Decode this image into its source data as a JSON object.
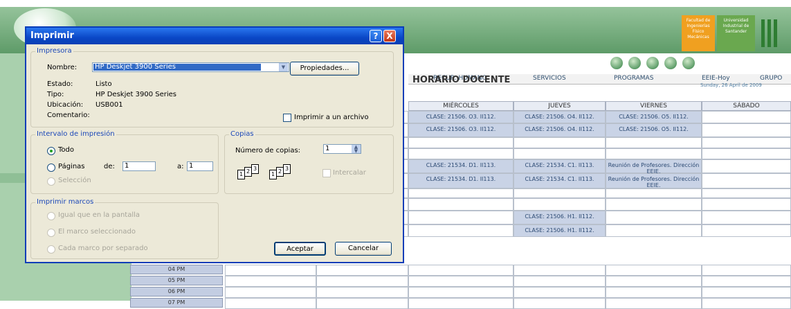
{
  "site": {
    "badge1": "Facultad de Ingenierías Físico Mecánicas",
    "badge2": "Universidad Industrial de Santander",
    "menu": [
      "RECUR. HUMANO",
      "SERVICIOS",
      "PROGRAMAS",
      "EEIE-Hoy",
      "GRUPO"
    ],
    "date": "Sunday, 26 April de 2009",
    "page_title": "HORARIO DOCENTE",
    "days": [
      "MIÉRCOLES",
      "JUEVES",
      "VIERNES",
      "SÁBADO"
    ],
    "rows": [
      [
        "CLASE: 21506. O3. II112.",
        "CLASE: 21506. O4. II112.",
        "CLASE: 21506. O5. II112.",
        ""
      ],
      [
        "CLASE: 21506. O3. II112.",
        "CLASE: 21506. O4. II112.",
        "CLASE: 21506. O5. II112.",
        ""
      ],
      [
        "",
        "",
        "",
        ""
      ],
      [
        "",
        "",
        "",
        ""
      ],
      [
        "CLASE: 21534. D1. II113.",
        "CLASE: 21534. C1. II113.",
        "Reunión de Profesores. Dirección EEIE.",
        ""
      ],
      [
        "CLASE: 21534. D1. II113.",
        "CLASE: 21534. C1. II113.",
        "Reunión de Profesores. Dirección EEIE.",
        ""
      ],
      [
        "",
        "",
        "",
        ""
      ],
      [
        "",
        "",
        "",
        ""
      ],
      [
        "",
        "CLASE: 21506. H1. II112.",
        "",
        ""
      ],
      [
        "",
        "CLASE: 21506. H1. II112.",
        "",
        ""
      ]
    ],
    "times": [
      "04 PM",
      "05 PM",
      "06 PM",
      "07 PM"
    ]
  },
  "dialog": {
    "title": "Imprimir",
    "help": "?",
    "close": "X",
    "printer": {
      "group_label": "Impresora",
      "name_label": "Nombre:",
      "name_value": "HP Deskjet 3900 Series",
      "properties_button": "Propiedades...",
      "status_label": "Estado:",
      "status_value": "Listo",
      "type_label": "Tipo:",
      "type_value": "HP Deskjet 3900 Series",
      "location_label": "Ubicación:",
      "location_value": "USB001",
      "comment_label": "Comentario:",
      "print_to_file": "Imprimir a un archivo"
    },
    "range": {
      "group_label": "Intervalo de impresión",
      "all": "Todo",
      "pages": "Páginas",
      "from_label": "de:",
      "from_value": "1",
      "to_label": "a:",
      "to_value": "1",
      "selection": "Selección"
    },
    "copies": {
      "group_label": "Copias",
      "count_label": "Número de copias:",
      "count_value": "1",
      "collate": "Intercalar",
      "page_numbers": [
        "1",
        "2",
        "3"
      ]
    },
    "frames": {
      "group_label": "Imprimir marcos",
      "as_screen": "Igual que en la pantalla",
      "selected_frame": "El marco seleccionado",
      "each_frame": "Cada marco por separado"
    },
    "ok_button": "Aceptar",
    "cancel_button": "Cancelar"
  }
}
